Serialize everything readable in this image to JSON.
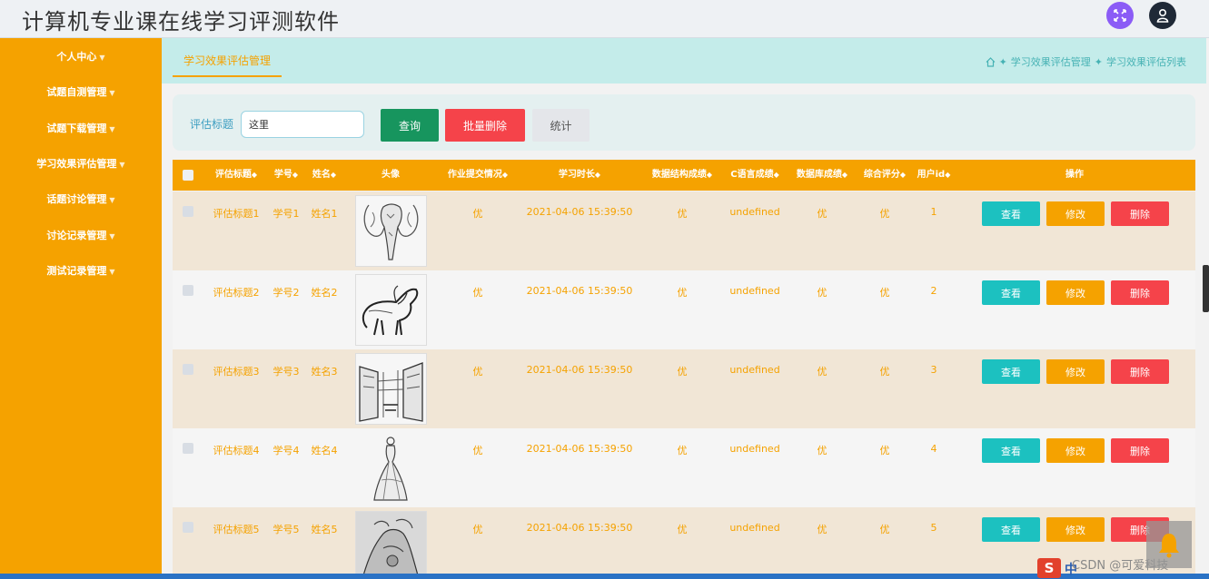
{
  "app": {
    "title": "计算机专业课在线学习评测软件"
  },
  "sidebar": {
    "items": [
      {
        "label": "个人中心"
      },
      {
        "label": "试题自测管理"
      },
      {
        "label": "试题下载管理"
      },
      {
        "label": "学习效果评估管理"
      },
      {
        "label": "话题讨论管理"
      },
      {
        "label": "讨论记录管理"
      },
      {
        "label": "测试记录管理"
      }
    ]
  },
  "tab": {
    "label": "学习效果评估管理"
  },
  "breadcrumb": {
    "sep": "✦",
    "items": [
      "学习效果评估管理",
      "学习效果评估列表"
    ]
  },
  "filter": {
    "label": "评估标题",
    "value": "这里",
    "query": "查询",
    "batch_delete": "批量删除",
    "stats": "统计"
  },
  "table": {
    "headers": [
      "评估标题",
      "学号",
      "姓名",
      "头像",
      "作业提交情况",
      "学习时长",
      "数据结构成绩",
      "C语言成绩",
      "数据库成绩",
      "综合评分",
      "用户id",
      "操作"
    ],
    "sort_icon": "◆",
    "actions": {
      "view": "查看",
      "edit": "修改",
      "delete": "删除"
    },
    "rows": [
      {
        "title": "评估标题1",
        "sno": "学号1",
        "name": "姓名1",
        "avatar": "elephant-drawing",
        "homework": "优",
        "duration": "2021-04-06 15:39:50",
        "ds": "优",
        "c": "undefined",
        "db": "优",
        "score": "优",
        "uid": "1"
      },
      {
        "title": "评估标题2",
        "sno": "学号2",
        "name": "姓名2",
        "avatar": "horse-drawing",
        "homework": "优",
        "duration": "2021-04-06 15:39:50",
        "ds": "优",
        "c": "undefined",
        "db": "优",
        "score": "优",
        "uid": "2"
      },
      {
        "title": "评估标题3",
        "sno": "学号3",
        "name": "姓名3",
        "avatar": "street-sketch",
        "homework": "优",
        "duration": "2021-04-06 15:39:50",
        "ds": "优",
        "c": "undefined",
        "db": "优",
        "score": "优",
        "uid": "3"
      },
      {
        "title": "评估标题4",
        "sno": "学号4",
        "name": "姓名4",
        "avatar": "dress-sketch",
        "homework": "优",
        "duration": "2021-04-06 15:39:50",
        "ds": "优",
        "c": "undefined",
        "db": "优",
        "score": "优",
        "uid": "4"
      },
      {
        "title": "评估标题5",
        "sno": "学号5",
        "name": "姓名5",
        "avatar": "garden-sketch",
        "homework": "优",
        "duration": "2021-04-06 15:39:50",
        "ds": "优",
        "c": "undefined",
        "db": "优",
        "score": "优",
        "uid": "5"
      }
    ]
  },
  "overlay": {
    "watermark": "CSDN @可爱科技",
    "ime_logo": "S",
    "ime_mode": "中"
  },
  "colors": {
    "accent": "#f5a200",
    "teal": "#1cc1c0",
    "danger": "#f5434a",
    "query": "#17955e"
  }
}
